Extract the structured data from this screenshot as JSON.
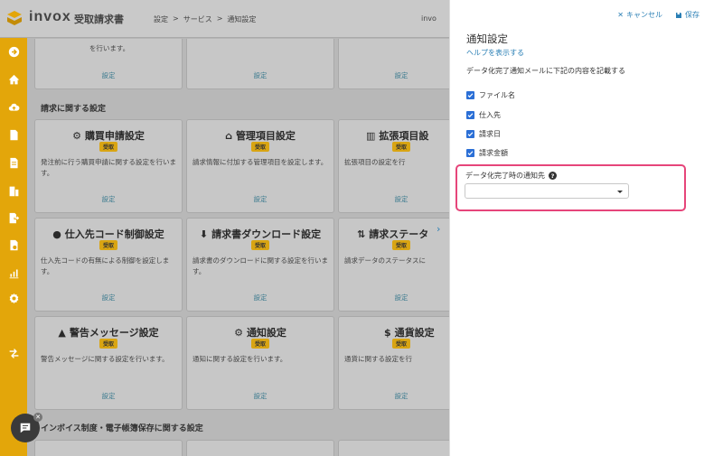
{
  "app": {
    "logo_text": "invox",
    "logo_subtitle": "受取請求書",
    "user_label": "invo"
  },
  "breadcrumb": [
    "設定",
    ">",
    "サービス",
    ">",
    "通知設定"
  ],
  "sidebar": {
    "icons": [
      "arrow-right-icon",
      "home-icon",
      "cloud-upload-icon",
      "document-icon",
      "document-list-icon",
      "building-icon",
      "export-icon",
      "file-settings-icon",
      "chart-icon",
      "gear-icon",
      "transfer-icon"
    ]
  },
  "content": {
    "top_row_partial_text": "を行います。",
    "top_row_links": [
      "設定",
      "設定",
      "設定"
    ],
    "section_invoice": "請求に関する設定",
    "section_tax": "インボイス制度・電子帳簿保存に関する設定",
    "cards": [
      {
        "title": "購買申請設定",
        "icon": "gears-icon",
        "badge": "受取",
        "desc": "発注前に行う購買申請に関する設定を行います。",
        "link": "設定"
      },
      {
        "title": "管理項目設定",
        "icon": "stamp-icon",
        "badge": "受取",
        "desc": "請求情報に付加する管理項目を設定します。",
        "link": "設定"
      },
      {
        "title": "拡張項目設",
        "icon": "building-icon",
        "badge": "受取",
        "desc": "拡張項目の設定を行",
        "link": "設定"
      },
      {
        "title": "仕入先コード制御設定",
        "icon": "abc-icon",
        "badge": "受取",
        "desc": "仕入先コードの有無による制御を設定します。",
        "link": "設定"
      },
      {
        "title": "請求書ダウンロード設定",
        "icon": "download-icon",
        "badge": "受取",
        "desc": "請求書のダウンロードに関する設定を行います。",
        "link": "設定"
      },
      {
        "title": "請求ステータ",
        "icon": "sort-icon",
        "badge": "受取",
        "desc": "請求データのステータスに",
        "link": "設定"
      },
      {
        "title": "警告メッセージ設定",
        "icon": "warning-icon",
        "badge": "受取",
        "desc": "警告メッセージに関する設定を行います。",
        "link": "設定"
      },
      {
        "title": "通知設定",
        "icon": "gears-icon",
        "badge": "受取",
        "desc": "通知に関する設定を行います。",
        "link": "設定"
      },
      {
        "title": "通貨設定",
        "icon": "dollar-icon",
        "badge": "受取",
        "desc": "通貨に関する設定を行",
        "link": "設定"
      }
    ]
  },
  "panel": {
    "cancel_label": "キャンセル",
    "save_label": "保存",
    "title": "通知設定",
    "help_link": "ヘルプを表示する",
    "description": "データ化完了通知メールに下記の内容を記載する",
    "checkboxes": [
      {
        "label": "ファイル名",
        "checked": true
      },
      {
        "label": "仕入先",
        "checked": true
      },
      {
        "label": "請求日",
        "checked": true
      },
      {
        "label": "請求金額",
        "checked": true
      }
    ],
    "notify_label": "データ化完了時の通知先",
    "notify_value": ""
  },
  "colors": {
    "accent": "#2a7fb5",
    "sidebar": "#e3a60a",
    "badge": "#d9a513",
    "highlight_border": "#e6457a"
  }
}
